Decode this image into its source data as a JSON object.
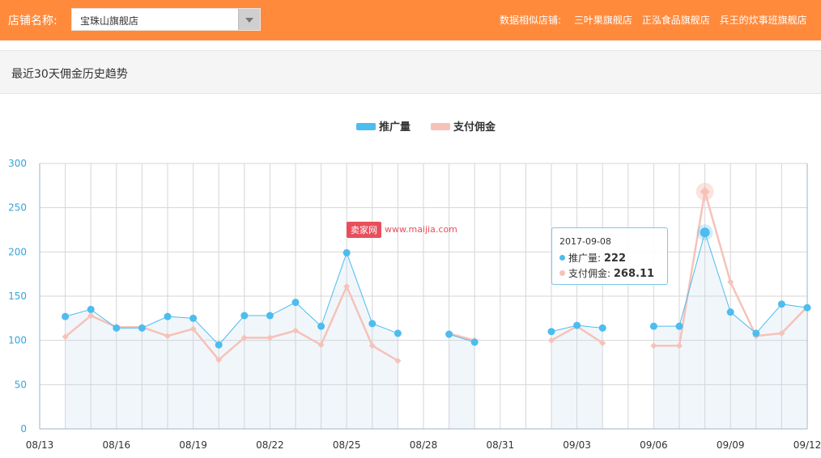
{
  "header": {
    "shop_label": "店铺名称:",
    "shop_select_value": "宝珠山旗舰店",
    "similar_label": "数据相似店铺:",
    "similar_shops": [
      "三叶果旗舰店",
      "正泓食品旗舰店",
      "兵王的炊事班旗舰店"
    ]
  },
  "section": {
    "title": "最近30天佣金历史趋势"
  },
  "watermark": {
    "badge": "卖家网",
    "url": "www.maijia.com"
  },
  "colors": {
    "accent": "#ff8a3c",
    "series_promo": "#4dbcef",
    "series_commission": "#f6c2b8",
    "grid": "#d6d6d6",
    "axis_text": "#3aa3d8"
  },
  "legend": [
    "推广量",
    "支付佣金"
  ],
  "tooltip": {
    "date": "2017-09-08",
    "rows": [
      {
        "label": "推广量:",
        "value": "222"
      },
      {
        "label": "支付佣金:",
        "value": "268.11"
      }
    ]
  },
  "chart_data": {
    "type": "line",
    "title": "",
    "xlabel": "",
    "ylabel": "",
    "ylim": [
      0,
      300
    ],
    "yticks": [
      0,
      50,
      100,
      150,
      200,
      250,
      300
    ],
    "grid": true,
    "legend_position": "top-center",
    "x": [
      "08/13",
      "08/14",
      "08/15",
      "08/16",
      "08/17",
      "08/18",
      "08/19",
      "08/20",
      "08/21",
      "08/22",
      "08/23",
      "08/24",
      "08/25",
      "08/26",
      "08/27",
      "08/28",
      "08/29",
      "08/30",
      "08/31",
      "09/01",
      "09/02",
      "09/03",
      "09/04",
      "09/05",
      "09/06",
      "09/07",
      "09/08",
      "09/09",
      "09/10",
      "09/11",
      "09/12"
    ],
    "xtick_labels": [
      "08/13",
      "08/16",
      "08/19",
      "08/22",
      "08/25",
      "08/28",
      "08/31",
      "09/03",
      "09/06",
      "09/09",
      "09/12"
    ],
    "series": [
      {
        "name": "推广量",
        "values": [
          null,
          127,
          135,
          114,
          114,
          127,
          125,
          95,
          128,
          128,
          143,
          116,
          199,
          119,
          108,
          null,
          107,
          98,
          null,
          null,
          110,
          117,
          114,
          null,
          116,
          116,
          222,
          132,
          108,
          141,
          137
        ]
      },
      {
        "name": "支付佣金",
        "values": [
          null,
          104,
          128,
          115,
          115,
          105,
          113,
          78,
          103,
          103,
          111,
          95,
          161,
          94,
          77,
          null,
          108,
          100,
          null,
          null,
          100,
          116,
          97,
          null,
          94,
          94,
          268.11,
          166,
          105,
          108,
          138
        ]
      }
    ],
    "highlight_x": "09/08"
  }
}
